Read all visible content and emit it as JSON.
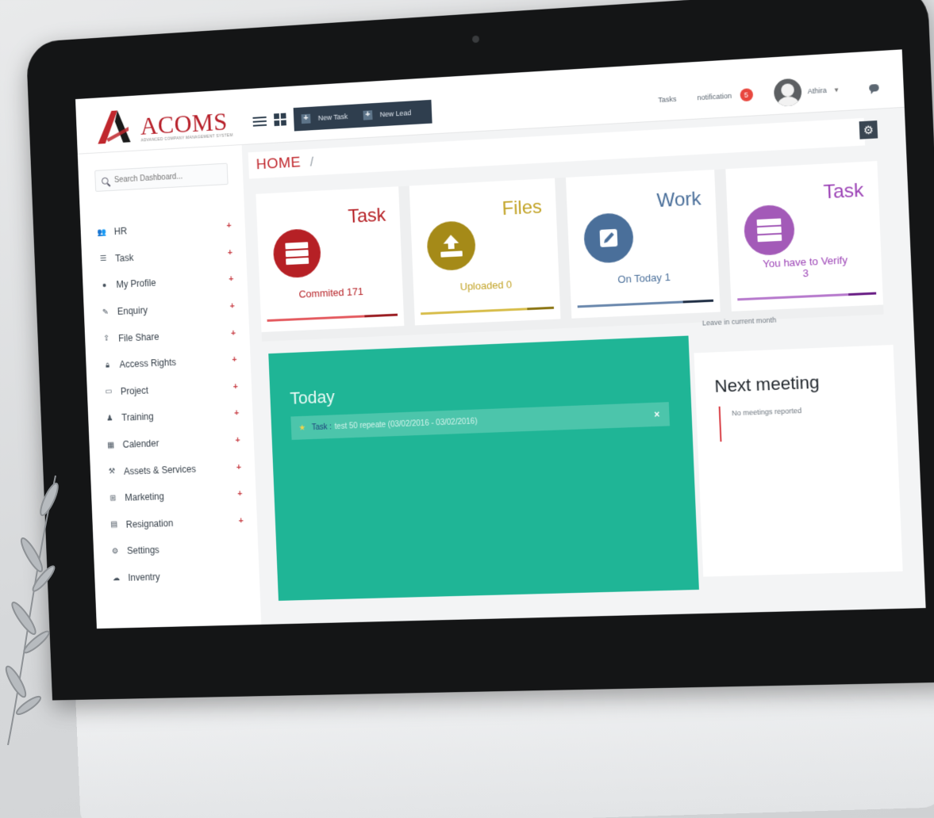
{
  "app": {
    "name": "ACOMS",
    "tagline": "ADVANCED COMPANY MANAGEMENT SYSTEM"
  },
  "toolbar": {
    "new_task": "New Task",
    "new_lead": "New Lead",
    "tasks_link": "Tasks",
    "notification_label": "notification",
    "notification_count": "5",
    "user_name": "Athira"
  },
  "search": {
    "placeholder": "Search Dashboard..."
  },
  "sidebar": {
    "items": [
      {
        "label": "HR",
        "icon": "users-icon"
      },
      {
        "label": "Task",
        "icon": "list-icon"
      },
      {
        "label": "My Profile",
        "icon": "user-icon"
      },
      {
        "label": "Enquiry",
        "icon": "edit-icon"
      },
      {
        "label": "File Share",
        "icon": "share-icon"
      },
      {
        "label": "Access Rights",
        "icon": "lock-icon"
      },
      {
        "label": "Project",
        "icon": "folder-icon"
      },
      {
        "label": "Training",
        "icon": "training-icon"
      },
      {
        "label": "Calender",
        "icon": "calendar-icon"
      },
      {
        "label": "Assets & Services",
        "icon": "wrench-icon"
      },
      {
        "label": "Marketing",
        "icon": "sitemap-icon"
      },
      {
        "label": "Resignation",
        "icon": "document-icon"
      },
      {
        "label": "Settings",
        "icon": "gear-icon"
      },
      {
        "label": "Inventry",
        "icon": "cloud-icon"
      }
    ]
  },
  "breadcrumb": {
    "home": "HOME",
    "separator": "/"
  },
  "cards": [
    {
      "title": "Task",
      "text": "Commited 171",
      "color": "#b62025",
      "icon": "server-icon"
    },
    {
      "title": "Files",
      "text": "Uploaded 0",
      "color": "#b59a1c",
      "icon": "upload-icon"
    },
    {
      "title": "Work",
      "text": "On Today 1",
      "color": "#4a6f9a",
      "icon": "pencil-icon"
    },
    {
      "title": "Task",
      "text": "You have to Verify\n3",
      "color": "#9c43b6",
      "icon": "server-icon"
    }
  ],
  "today": {
    "heading": "Today",
    "task_key": "Task :",
    "task_text": "test 50 repeate (03/02/2016 - 03/02/2016)",
    "close": "×"
  },
  "leave": {
    "label": "Leave in current month"
  },
  "meeting": {
    "heading": "Next meeting",
    "empty": "No meetings reported"
  },
  "colors": {
    "brand": "#b7202a",
    "panel_green": "#1fb596",
    "navbar_dark": "#2f3e4e"
  }
}
